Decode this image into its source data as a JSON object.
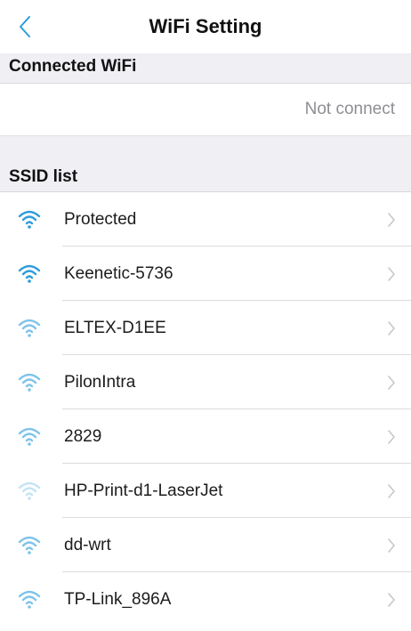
{
  "navbar": {
    "title": "WiFi Setting",
    "back_icon": "chevron-left-icon"
  },
  "connected": {
    "header": "Connected WiFi",
    "value": "Not connect"
  },
  "ssid": {
    "header": "SSID list",
    "items": [
      {
        "name": "Protected",
        "strength": "strong"
      },
      {
        "name": "Keenetic-5736",
        "strength": "strong"
      },
      {
        "name": "ELTEX-D1EE",
        "strength": "medium"
      },
      {
        "name": "PilonIntra",
        "strength": "medium"
      },
      {
        "name": "2829",
        "strength": "medium"
      },
      {
        "name": "HP-Print-d1-LaserJet",
        "strength": "weak"
      },
      {
        "name": "dd-wrt",
        "strength": "medium"
      },
      {
        "name": "TP-Link_896A",
        "strength": "medium"
      }
    ]
  },
  "colors": {
    "accent": "#2d9cdb",
    "signal_strong": "#2d9cdb",
    "signal_medium": "#7fc3ea",
    "signal_weak": "#c4e3f5",
    "section_background": "#efeff4",
    "secondary_text": "#8e8e93",
    "chevron": "#c7c7cc"
  }
}
